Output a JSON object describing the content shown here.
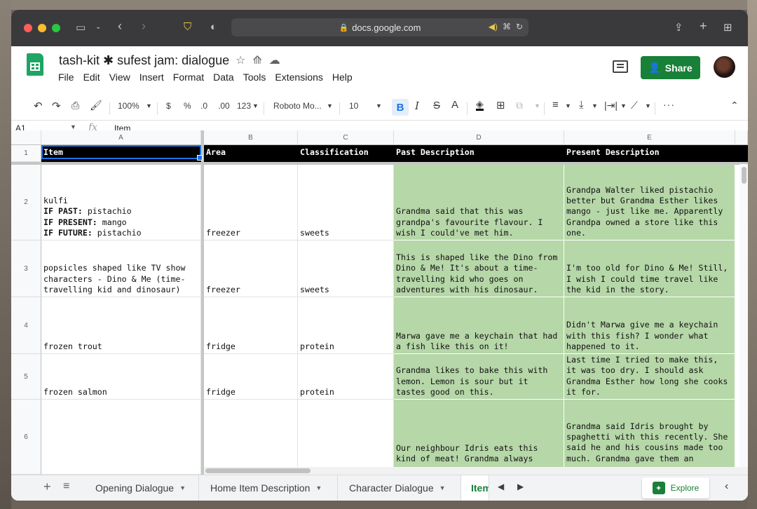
{
  "browser": {
    "url": "docs.google.com"
  },
  "doc": {
    "title": "tash-kit ✱ sufest jam: dialogue",
    "menu": [
      "File",
      "Edit",
      "View",
      "Insert",
      "Format",
      "Data",
      "Tools",
      "Extensions",
      "Help"
    ],
    "share_label": "Share"
  },
  "toolbar": {
    "zoom": "100%",
    "currency": "$",
    "percent": "%",
    "dec_less": ".0",
    "dec_more": ".00",
    "number_format": "123",
    "font": "Roboto Mo...",
    "font_size": "10",
    "bold": "B",
    "italic": "I",
    "strike": "S",
    "text_color": "A"
  },
  "formula_bar": {
    "cell_ref": "A1",
    "fx": "fx",
    "value": "Item"
  },
  "columns": [
    "A",
    "B",
    "C",
    "D",
    "E"
  ],
  "rows": [
    "1",
    "2",
    "3",
    "4",
    "5",
    "6"
  ],
  "header": {
    "item": "Item",
    "area": "Area",
    "classification": "Classification",
    "past": "Past Description",
    "present": "Present Description"
  },
  "table": [
    {
      "item_name": "kulfi",
      "past_prefix": "IF PAST:",
      "past_val": " pistachio",
      "present_prefix": "IF PRESENT:",
      "present_val": " mango",
      "future_prefix": "IF FUTURE:",
      "future_val": " pistachio",
      "area": "freezer",
      "classification": "sweets",
      "past": "Grandma said that this was grandpa's favourite flavour. I wish I could've met him.",
      "present": "Grandpa Walter liked pistachio better but Grandma Esther likes mango - just like me. Apparently Grandpa owned a store like this one."
    },
    {
      "item_name": "popsicles shaped like TV show characters - Dino & Me (time-travelling kid and dinosaur)",
      "area": "freezer",
      "classification": "sweets",
      "past": "This is shaped like the Dino from Dino & Me! It's about a time-travelling kid who goes on adventures with his dinosaur.",
      "present": "I'm too old for Dino & Me! Still, I wish I could time travel like the kid in the story."
    },
    {
      "item_name": "frozen trout",
      "area": "fridge",
      "classification": "protein",
      "past": "Marwa gave me a keychain that had a fish like this on it!",
      "present": "Didn't Marwa give me a keychain with this fish? I wonder what happened to it."
    },
    {
      "item_name": "frozen salmon",
      "area": "fridge",
      "classification": "protein",
      "past": "Grandma likes to bake this with lemon. Lemon is sour but it tastes good on this.",
      "present": "Last time I tried to make this, it was too dry. I should ask Grandma Esther how long she cooks it for."
    },
    {
      "item_name": "",
      "area": "",
      "classification": "",
      "past": "Our neighbour Idris eats this kind of meat! Grandma always",
      "present": "Grandma said Idris brought by spaghetti with this recently. She said he and his cousins made too much. Grandma gave them an"
    }
  ],
  "sheet_tabs": [
    "Opening Dialogue",
    "Home Item Description",
    "Character Dialogue",
    "Item"
  ],
  "explore_label": "Explore",
  "colors": {
    "green_fill": "#b6d7a8",
    "header_fill": "#000000",
    "share_green": "#188038",
    "selection_blue": "#1a73e8"
  }
}
